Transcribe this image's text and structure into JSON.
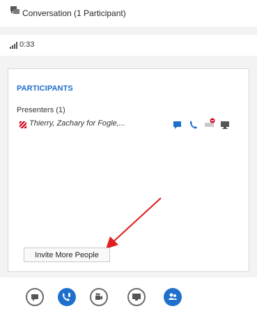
{
  "window": {
    "title": "Conversation (1 Participant)"
  },
  "status": {
    "duration": "0:33"
  },
  "participants": {
    "heading": "PARTICIPANTS",
    "presenters_label": "Presenters (1)",
    "presenters": [
      {
        "name": "Thierry, Zachary for Fogle,...",
        "presence_color": "#d0021b"
      }
    ]
  },
  "invite_button": {
    "label": "Invite More People"
  },
  "bottom_toolbar": {
    "buttons": [
      {
        "icon": "im-icon",
        "active": false
      },
      {
        "icon": "phone-mic-icon",
        "active": true
      },
      {
        "icon": "video-icon",
        "active": false
      },
      {
        "icon": "present-icon",
        "active": false
      },
      {
        "icon": "people-icon",
        "active": true
      }
    ]
  },
  "colors": {
    "accent": "#1f6fcc",
    "annotation_arrow": "#e02020"
  }
}
